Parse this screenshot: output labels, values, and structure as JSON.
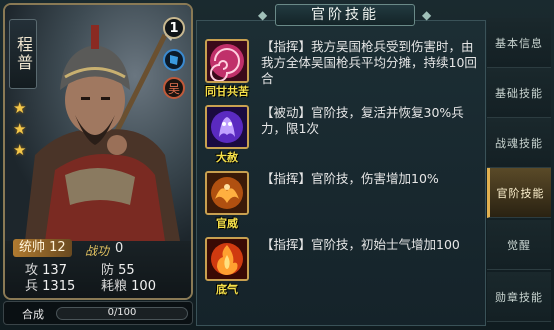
{
  "hero": {
    "name": "程普",
    "level": "1",
    "faction": "吴",
    "stars": 3,
    "command_label": "统帅",
    "command_value": "12",
    "battle_label": "战功",
    "battle_value": "0",
    "attack_label": "攻",
    "attack_value": "137",
    "defense_label": "防",
    "defense_value": "55",
    "troops_label": "兵",
    "troops_value": "1315",
    "food_label": "耗粮",
    "food_value": "100"
  },
  "synthesis": {
    "label": "合成",
    "progress_text": "0/100",
    "progress": 0
  },
  "panel": {
    "title": "官阶技能"
  },
  "skills": [
    {
      "name": "同甘共苦",
      "name_color": "#f5e04a",
      "desc": "【指挥】我方吴国枪兵受到伤害时，由我方全体吴国枪兵平均分摊，持续10回合",
      "icon": "vortex-icon"
    },
    {
      "name": "大赦",
      "name_color": "#f5e04a",
      "desc": "【被动】官阶技，复活并恢复30%兵力，限1次",
      "icon": "spirit-icon"
    },
    {
      "name": "官威",
      "name_color": "#f5e04a",
      "desc": "【指挥】官阶技，伤害增加10%",
      "icon": "phoenix-icon"
    },
    {
      "name": "底气",
      "name_color": "#f5e04a",
      "desc": "【指挥】官阶技，初始士气增加100",
      "icon": "flame-icon"
    }
  ],
  "tabs": [
    {
      "label": "基本信息",
      "active": false
    },
    {
      "label": "基础技能",
      "active": false
    },
    {
      "label": "战魂技能",
      "active": false
    },
    {
      "label": "官阶技能",
      "active": true
    },
    {
      "label": "觉醒",
      "active": false
    },
    {
      "label": "勋章技能",
      "active": false
    }
  ]
}
